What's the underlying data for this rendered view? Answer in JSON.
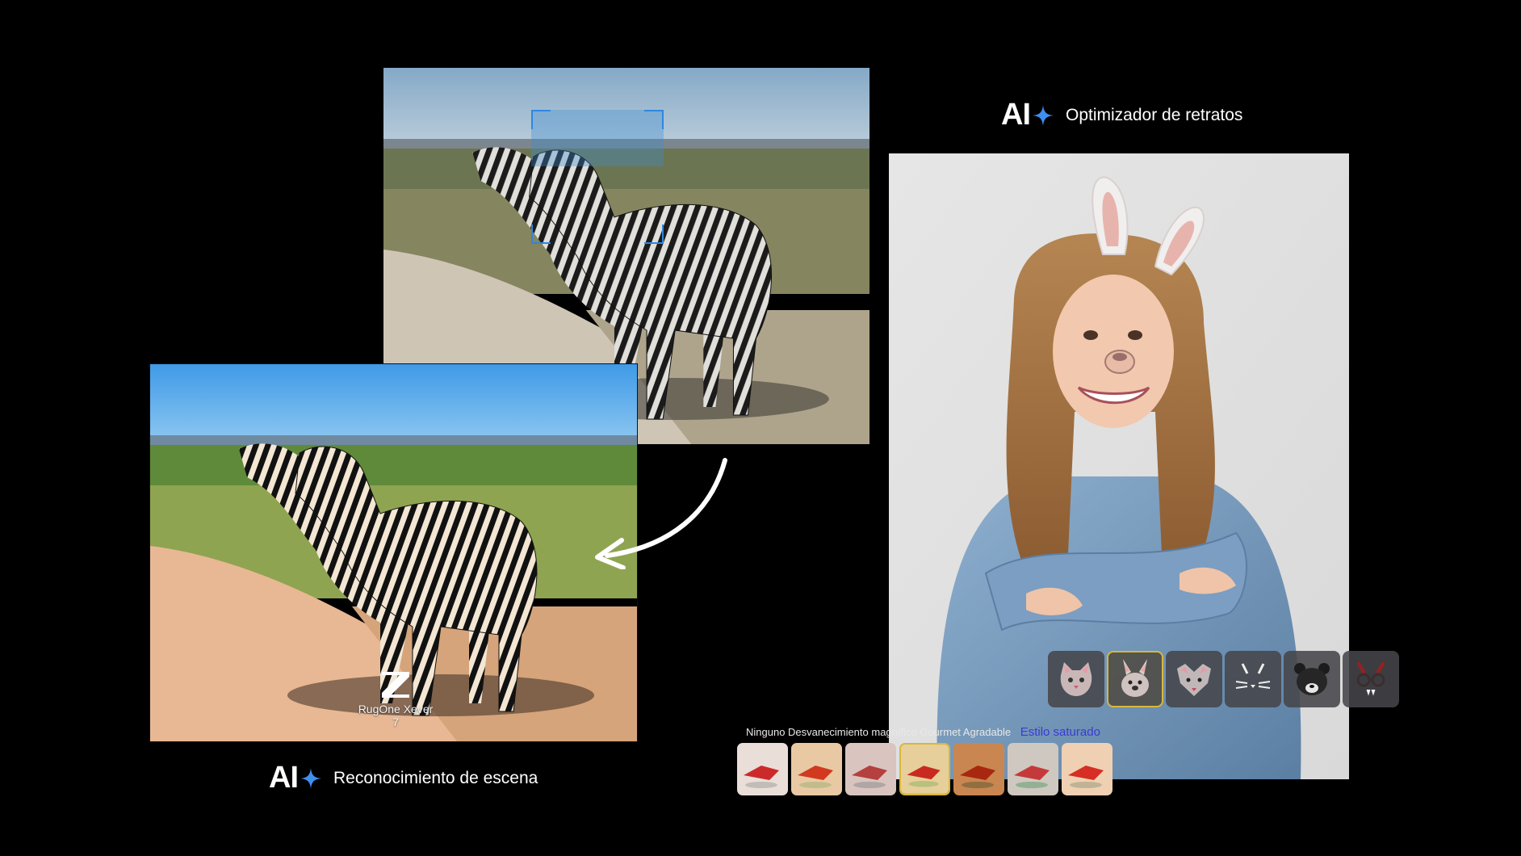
{
  "scene_section": {
    "title_ai": "AI",
    "title_label": "Reconocimiento de escena",
    "watermark_text": "RugOne Xever 7"
  },
  "portrait_section": {
    "title_ai": "AI",
    "title_label": "Optimizador de retratos"
  },
  "filters": {
    "labels_text": "Ninguno Desvanecimiento magnífico Gourmet Agradable",
    "active_label": "Estilo saturado",
    "selected_index": 3
  },
  "face_filters": {
    "items": [
      "cat-mask-icon",
      "bunny-mask-icon",
      "fox-mask-icon",
      "whiskers-mask-icon",
      "bear-mask-icon",
      "devil-glasses-icon"
    ],
    "selected_index": 1
  },
  "colors": {
    "accent_blue": "#2f86e0",
    "selection_gold": "#d8b73c",
    "active_filter_text": "#3a3ad8",
    "background": "#000000"
  }
}
